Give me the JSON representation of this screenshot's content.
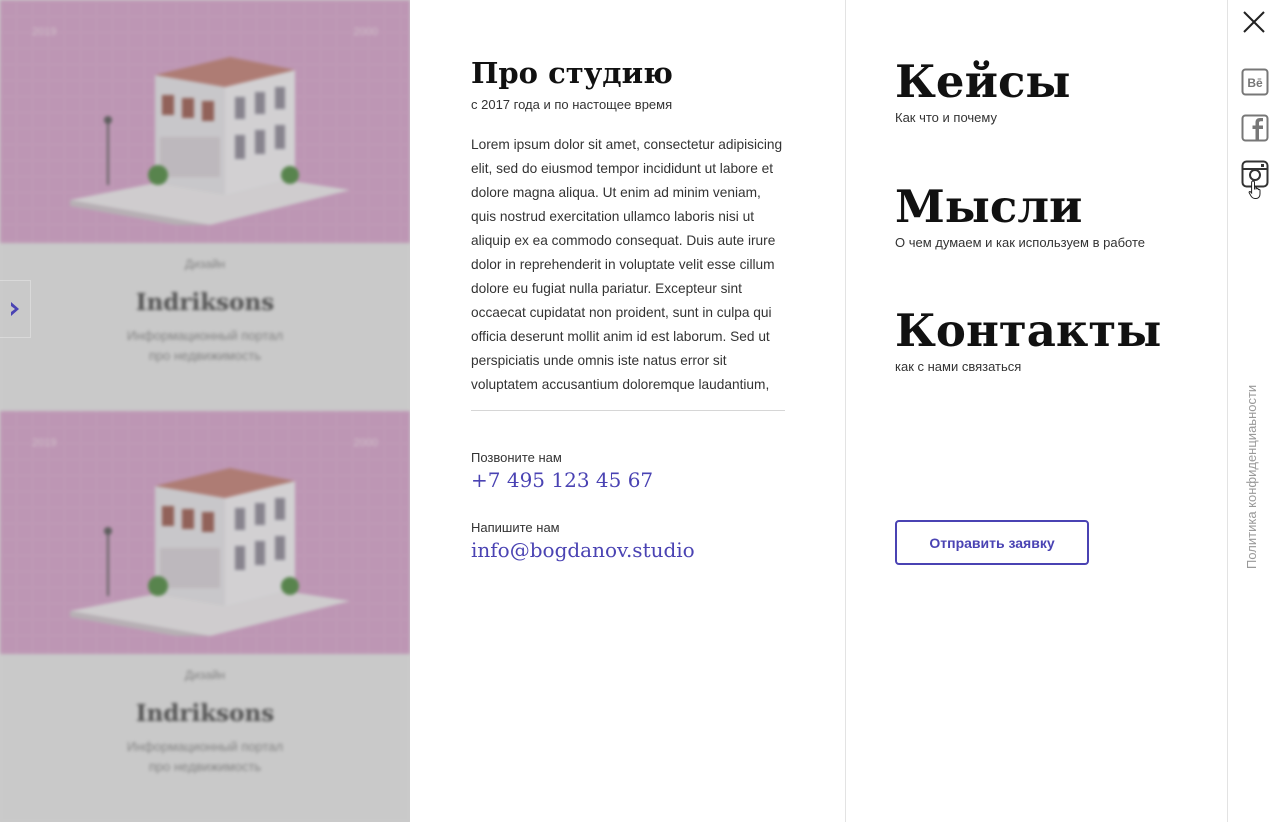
{
  "portfolio": {
    "cards": [
      {
        "year": "2019",
        "tag": "2000",
        "category": "Дизайн",
        "title": "Indriksons",
        "desc_line1": "Информационный портал",
        "desc_line2": "про недвижимость"
      },
      {
        "year": "2019",
        "tag": "2000",
        "category": "Дизайн",
        "title": "Indriksons",
        "desc_line1": "Информационный портал",
        "desc_line2": "про недвижимость"
      }
    ]
  },
  "about": {
    "title": "Про студию",
    "subtitle": "с 2017  года и по настощее время",
    "text": "Lorem ipsum dolor sit amet, consectetur adipisicing elit, sed do eiusmod tempor incididunt ut labore et dolore magna aliqua. Ut enim ad minim veniam, quis nostrud exercitation ullamco laboris nisi ut aliquip ex ea commodo consequat. Duis aute irure dolor in reprehenderit in voluptate velit esse cillum dolore eu fugiat nulla pariatur. Excepteur sint occaecat cupidatat non proident, sunt in culpa qui officia deserunt mollit anim id est laborum. Sed ut perspiciatis unde omnis iste natus error sit voluptatem accusantium doloremque laudantium,",
    "call_label": "Позвоните нам",
    "phone": "+7 495 123 45 67",
    "write_label": "Напишите нам",
    "email": "info@bogdanov.studio"
  },
  "menu": {
    "items": [
      {
        "label": "Кейсы",
        "sub": "Как что и почему"
      },
      {
        "label": "Мысли",
        "sub": "О чем думаем и как используем  в работе"
      },
      {
        "label": "Контакты",
        "sub": "как с нами связаться"
      }
    ],
    "cta": "Отправить заявку"
  },
  "rail": {
    "social": [
      "behance-icon",
      "facebook-icon",
      "instagram-icon"
    ],
    "privacy": "Политика конфиденциаьности"
  },
  "colors": {
    "accent": "#4a43b3",
    "card_bg": "#d9a3cc"
  }
}
